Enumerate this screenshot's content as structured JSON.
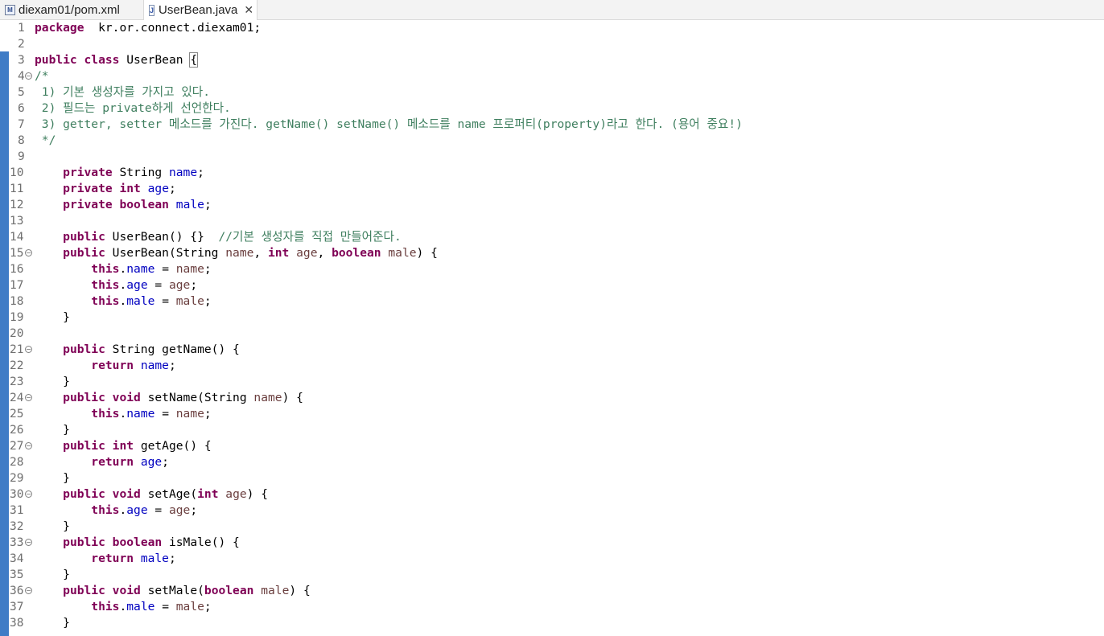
{
  "tabs": [
    {
      "label": "diexam01/pom.xml",
      "icon": "maven-file-icon",
      "active": false
    },
    {
      "label": "UserBean.java",
      "icon": "java-file-icon",
      "active": true
    }
  ],
  "colors": {
    "keyword": "#7f0055",
    "field": "#0000c0",
    "parameter": "#6a3e3e",
    "comment": "#3f7f5f",
    "ruler": "#3f7cc6"
  },
  "editor": {
    "lines": [
      {
        "n": "1",
        "fold": false,
        "segs": [
          [
            "k",
            "package"
          ],
          [
            "",
            "  kr.or.connect.diexam01;"
          ]
        ]
      },
      {
        "n": "2",
        "fold": false,
        "segs": []
      },
      {
        "n": "3",
        "fold": false,
        "segs": [
          [
            "k",
            "public"
          ],
          [
            "",
            " "
          ],
          [
            "k",
            "class"
          ],
          [
            "",
            " UserBean "
          ],
          [
            "b",
            "{"
          ]
        ]
      },
      {
        "n": "4",
        "fold": true,
        "segs": [
          [
            "c",
            "/*"
          ]
        ]
      },
      {
        "n": "5",
        "fold": false,
        "segs": [
          [
            "c",
            " 1) 기본 생성자를 가지고 있다."
          ]
        ]
      },
      {
        "n": "6",
        "fold": false,
        "segs": [
          [
            "c",
            " 2) 필드는 private하게 선언한다."
          ]
        ]
      },
      {
        "n": "7",
        "fold": false,
        "segs": [
          [
            "c",
            " 3) getter, setter 메소드를 가진다. getName() setName() 메소드를 name 프로퍼티(property)라고 한다. (용어 중요!)"
          ]
        ]
      },
      {
        "n": "8",
        "fold": false,
        "segs": [
          [
            "c",
            " */"
          ]
        ]
      },
      {
        "n": "9",
        "fold": false,
        "segs": []
      },
      {
        "n": "10",
        "fold": false,
        "segs": [
          [
            "",
            "    "
          ],
          [
            "k",
            "private"
          ],
          [
            "",
            " String "
          ],
          [
            "f",
            "name"
          ],
          [
            "",
            ";"
          ]
        ]
      },
      {
        "n": "11",
        "fold": false,
        "segs": [
          [
            "",
            "    "
          ],
          [
            "k",
            "private"
          ],
          [
            "",
            " "
          ],
          [
            "k",
            "int"
          ],
          [
            "",
            " "
          ],
          [
            "f",
            "age"
          ],
          [
            "",
            ";"
          ]
        ]
      },
      {
        "n": "12",
        "fold": false,
        "segs": [
          [
            "",
            "    "
          ],
          [
            "k",
            "private"
          ],
          [
            "",
            " "
          ],
          [
            "k",
            "boolean"
          ],
          [
            "",
            " "
          ],
          [
            "f",
            "male"
          ],
          [
            "",
            ";"
          ]
        ]
      },
      {
        "n": "13",
        "fold": false,
        "segs": []
      },
      {
        "n": "14",
        "fold": false,
        "segs": [
          [
            "",
            "    "
          ],
          [
            "k",
            "public"
          ],
          [
            "",
            " UserBean() {}  "
          ],
          [
            "c",
            "//기본 생성자를 직접 만들어준다."
          ]
        ]
      },
      {
        "n": "15",
        "fold": true,
        "segs": [
          [
            "",
            "    "
          ],
          [
            "k",
            "public"
          ],
          [
            "",
            " UserBean(String "
          ],
          [
            "p",
            "name"
          ],
          [
            "",
            ", "
          ],
          [
            "k",
            "int"
          ],
          [
            "",
            " "
          ],
          [
            "p",
            "age"
          ],
          [
            "",
            ", "
          ],
          [
            "k",
            "boolean"
          ],
          [
            "",
            " "
          ],
          [
            "p",
            "male"
          ],
          [
            "",
            ") {"
          ]
        ]
      },
      {
        "n": "16",
        "fold": false,
        "segs": [
          [
            "",
            "        "
          ],
          [
            "k",
            "this"
          ],
          [
            "",
            "."
          ],
          [
            "f",
            "name"
          ],
          [
            "",
            " = "
          ],
          [
            "p",
            "name"
          ],
          [
            "",
            ";"
          ]
        ]
      },
      {
        "n": "17",
        "fold": false,
        "segs": [
          [
            "",
            "        "
          ],
          [
            "k",
            "this"
          ],
          [
            "",
            "."
          ],
          [
            "f",
            "age"
          ],
          [
            "",
            " = "
          ],
          [
            "p",
            "age"
          ],
          [
            "",
            ";"
          ]
        ]
      },
      {
        "n": "18",
        "fold": false,
        "segs": [
          [
            "",
            "        "
          ],
          [
            "k",
            "this"
          ],
          [
            "",
            "."
          ],
          [
            "f",
            "male"
          ],
          [
            "",
            " = "
          ],
          [
            "p",
            "male"
          ],
          [
            "",
            ";"
          ]
        ]
      },
      {
        "n": "19",
        "fold": false,
        "segs": [
          [
            "",
            "    }"
          ]
        ]
      },
      {
        "n": "20",
        "fold": false,
        "segs": []
      },
      {
        "n": "21",
        "fold": true,
        "segs": [
          [
            "",
            "    "
          ],
          [
            "k",
            "public"
          ],
          [
            "",
            " String getName() {"
          ]
        ]
      },
      {
        "n": "22",
        "fold": false,
        "segs": [
          [
            "",
            "        "
          ],
          [
            "k",
            "return"
          ],
          [
            "",
            " "
          ],
          [
            "f",
            "name"
          ],
          [
            "",
            ";"
          ]
        ]
      },
      {
        "n": "23",
        "fold": false,
        "segs": [
          [
            "",
            "    }"
          ]
        ]
      },
      {
        "n": "24",
        "fold": true,
        "segs": [
          [
            "",
            "    "
          ],
          [
            "k",
            "public"
          ],
          [
            "",
            " "
          ],
          [
            "k",
            "void"
          ],
          [
            "",
            " setName(String "
          ],
          [
            "p",
            "name"
          ],
          [
            "",
            ") {"
          ]
        ]
      },
      {
        "n": "25",
        "fold": false,
        "segs": [
          [
            "",
            "        "
          ],
          [
            "k",
            "this"
          ],
          [
            "",
            "."
          ],
          [
            "f",
            "name"
          ],
          [
            "",
            " = "
          ],
          [
            "p",
            "name"
          ],
          [
            "",
            ";"
          ]
        ]
      },
      {
        "n": "26",
        "fold": false,
        "segs": [
          [
            "",
            "    }"
          ]
        ]
      },
      {
        "n": "27",
        "fold": true,
        "segs": [
          [
            "",
            "    "
          ],
          [
            "k",
            "public"
          ],
          [
            "",
            " "
          ],
          [
            "k",
            "int"
          ],
          [
            "",
            " getAge() {"
          ]
        ]
      },
      {
        "n": "28",
        "fold": false,
        "segs": [
          [
            "",
            "        "
          ],
          [
            "k",
            "return"
          ],
          [
            "",
            " "
          ],
          [
            "f",
            "age"
          ],
          [
            "",
            ";"
          ]
        ]
      },
      {
        "n": "29",
        "fold": false,
        "segs": [
          [
            "",
            "    }"
          ]
        ]
      },
      {
        "n": "30",
        "fold": true,
        "segs": [
          [
            "",
            "    "
          ],
          [
            "k",
            "public"
          ],
          [
            "",
            " "
          ],
          [
            "k",
            "void"
          ],
          [
            "",
            " setAge("
          ],
          [
            "k",
            "int"
          ],
          [
            "",
            " "
          ],
          [
            "p",
            "age"
          ],
          [
            "",
            ") {"
          ]
        ]
      },
      {
        "n": "31",
        "fold": false,
        "segs": [
          [
            "",
            "        "
          ],
          [
            "k",
            "this"
          ],
          [
            "",
            "."
          ],
          [
            "f",
            "age"
          ],
          [
            "",
            " = "
          ],
          [
            "p",
            "age"
          ],
          [
            "",
            ";"
          ]
        ]
      },
      {
        "n": "32",
        "fold": false,
        "segs": [
          [
            "",
            "    }"
          ]
        ]
      },
      {
        "n": "33",
        "fold": true,
        "segs": [
          [
            "",
            "    "
          ],
          [
            "k",
            "public"
          ],
          [
            "",
            " "
          ],
          [
            "k",
            "boolean"
          ],
          [
            "",
            " isMale() {"
          ]
        ]
      },
      {
        "n": "34",
        "fold": false,
        "segs": [
          [
            "",
            "        "
          ],
          [
            "k",
            "return"
          ],
          [
            "",
            " "
          ],
          [
            "f",
            "male"
          ],
          [
            "",
            ";"
          ]
        ]
      },
      {
        "n": "35",
        "fold": false,
        "segs": [
          [
            "",
            "    }"
          ]
        ]
      },
      {
        "n": "36",
        "fold": true,
        "segs": [
          [
            "",
            "    "
          ],
          [
            "k",
            "public"
          ],
          [
            "",
            " "
          ],
          [
            "k",
            "void"
          ],
          [
            "",
            " setMale("
          ],
          [
            "k",
            "boolean"
          ],
          [
            "",
            " "
          ],
          [
            "p",
            "male"
          ],
          [
            "",
            ") {"
          ]
        ]
      },
      {
        "n": "37",
        "fold": false,
        "segs": [
          [
            "",
            "        "
          ],
          [
            "k",
            "this"
          ],
          [
            "",
            "."
          ],
          [
            "f",
            "male"
          ],
          [
            "",
            " = "
          ],
          [
            "p",
            "male"
          ],
          [
            "",
            ";"
          ]
        ]
      },
      {
        "n": "38",
        "fold": false,
        "segs": [
          [
            "",
            "    }"
          ]
        ]
      }
    ]
  }
}
